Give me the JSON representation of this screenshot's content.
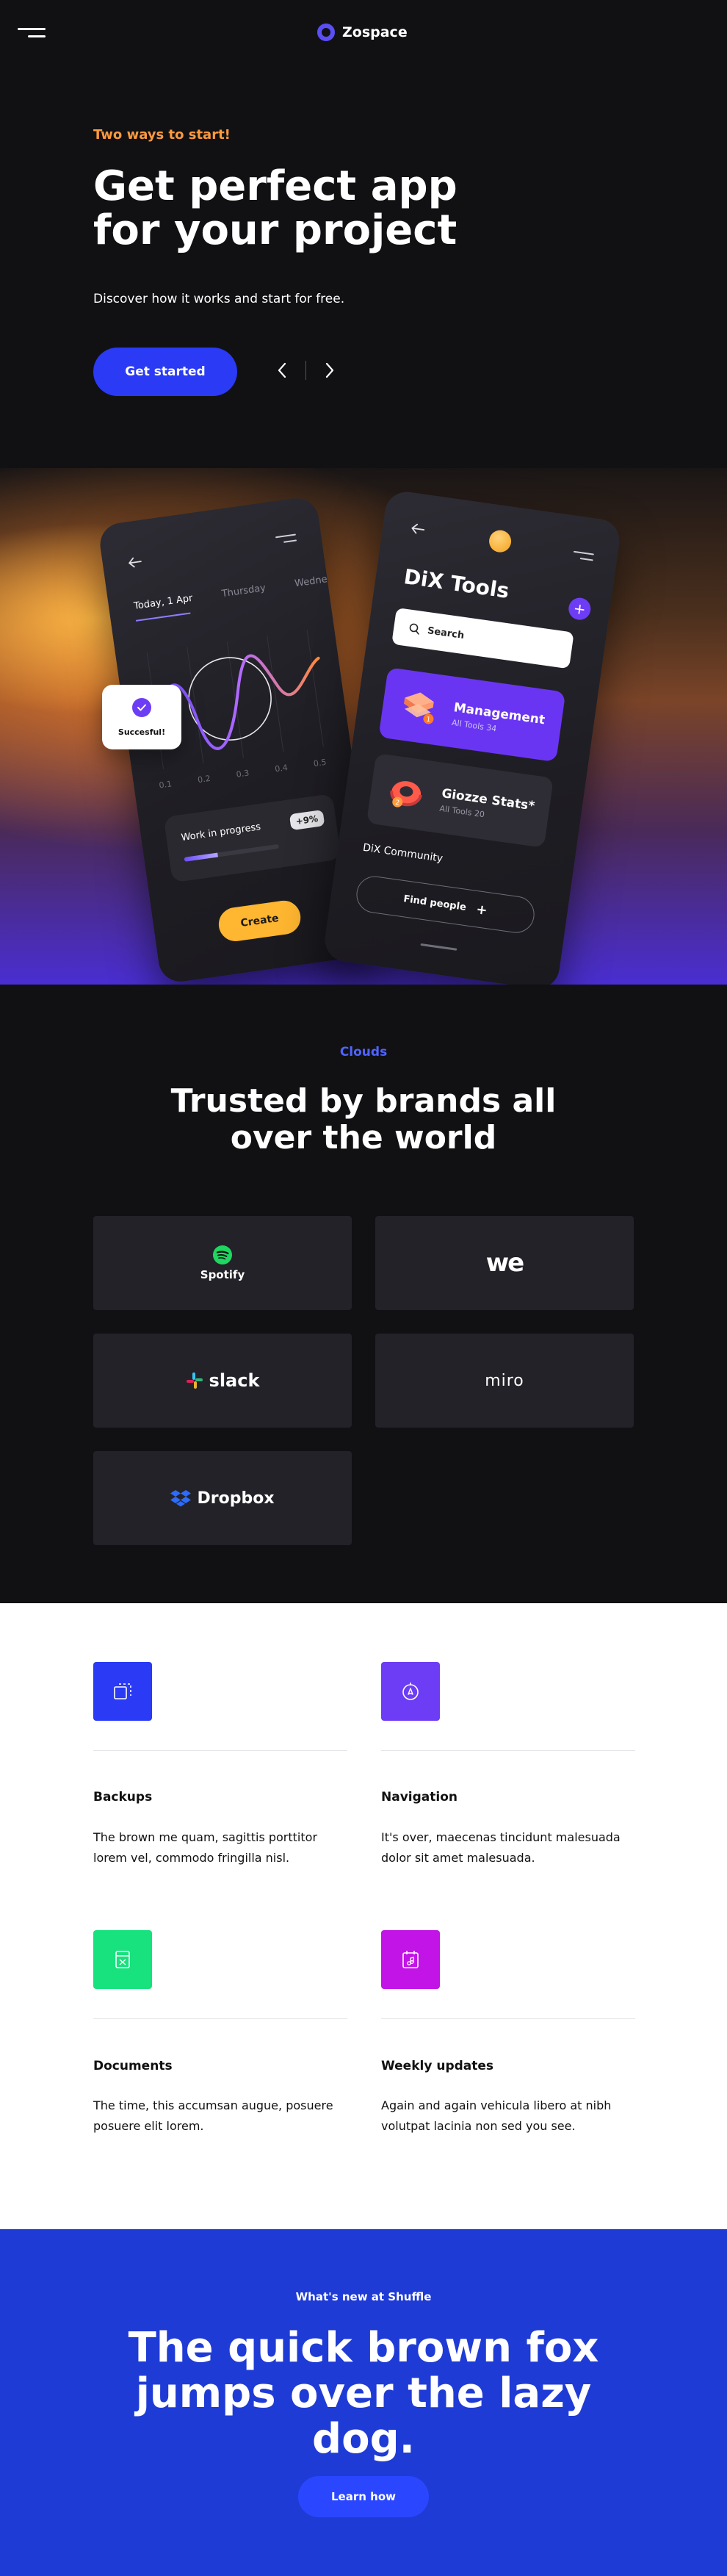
{
  "header": {
    "brand": "Zospace",
    "menu_icon": "hamburger-menu-icon",
    "logo_icon": "ring-logo-icon"
  },
  "hero": {
    "eyebrow": "Two ways to start!",
    "title": "Get perfect app for your project",
    "subtitle": "Discover how it works and start for free.",
    "cta_label": "Get started",
    "prev_icon": "chevron-left-icon",
    "next_icon": "chevron-right-icon",
    "colors": {
      "accent": "#2a3af5",
      "eyebrow": "#ff9a3c",
      "purple": "#6d3df5"
    }
  },
  "phone_left": {
    "days": [
      "Today, 1 Apr",
      "Thursday",
      "Wednesd"
    ],
    "ticks": [
      "0.1",
      "0.2",
      "0.3",
      "0.4",
      "0.5"
    ],
    "work_label": "Work in progress",
    "work_badge": "+9%",
    "work_progress": 0.35,
    "create_label": "Create"
  },
  "success_popup": {
    "label": "Succesful!"
  },
  "phone_right": {
    "title": "DiX Tools",
    "search_label": "Search",
    "cards": [
      {
        "title": "Management",
        "subtitle": "All Tools 34",
        "badge": "1"
      },
      {
        "title": "Giozze Stats*",
        "subtitle": "All Tools 20",
        "badge": "2"
      }
    ],
    "community_label": "DiX Community",
    "find_label": "Find people"
  },
  "brands": {
    "eyebrow": "Clouds",
    "title": "Trusted by brands all over the world",
    "items": [
      {
        "name": "Spotify",
        "icon": "spotify-logo-icon"
      },
      {
        "name": "we",
        "icon": "wetransfer-logo-icon"
      },
      {
        "name": "slack",
        "icon": "slack-logo-icon"
      },
      {
        "name": "miro",
        "icon": "miro-logo-icon"
      },
      {
        "name": "Dropbox",
        "icon": "dropbox-logo-icon"
      }
    ]
  },
  "features": [
    {
      "title": "Backups",
      "text": "The brown me quam, sagittis porttitor lorem vel, commodo fringilla nisl.",
      "color": "#2a3af5",
      "icon": "backup-icon"
    },
    {
      "title": "Navigation",
      "text": "It's over, maecenas tincidunt malesuada dolor sit amet malesuada.",
      "color": "#6d3df5",
      "icon": "navigation-icon"
    },
    {
      "title": "Documents",
      "text": "The time, this accumsan augue, posuere posuere elit lorem.",
      "color": "#17e27e",
      "icon": "document-icon"
    },
    {
      "title": "Weekly updates",
      "text": "Again and again vehicula libero at nibh volutpat lacinia non sed you see.",
      "color": "#c214e6",
      "icon": "calendar-music-icon"
    }
  ],
  "cta": {
    "eyebrow": "What's new at Shuffle",
    "title": "The quick brown fox jumps over the lazy dog.",
    "button_label": "Learn how"
  }
}
